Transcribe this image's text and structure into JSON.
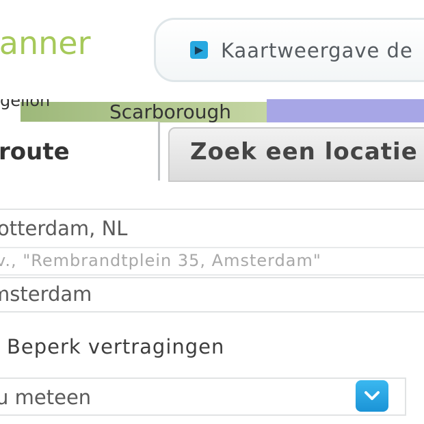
{
  "header": {
    "title": "lanner",
    "map_view_label": "Kaartweergave de",
    "map_view_icon": "arrow-right-icon"
  },
  "map": {
    "label_left": "gelion",
    "label_scarborough": "Scarborough"
  },
  "tabs": {
    "route_label": "route",
    "search_label": "Zoek een locatie"
  },
  "form": {
    "from_value": "otterdam, NL",
    "via_placeholder": "v., \"Rembrandtplein 35, Amsterdam\"",
    "to_value": "msterdam",
    "option_label": "Beperk vertragingen",
    "departure_value": "lu meteen",
    "departure_icon": "chevron-down-icon"
  },
  "colors": {
    "title_green": "#a6c95a",
    "accent_blue": "#28a8e0"
  }
}
